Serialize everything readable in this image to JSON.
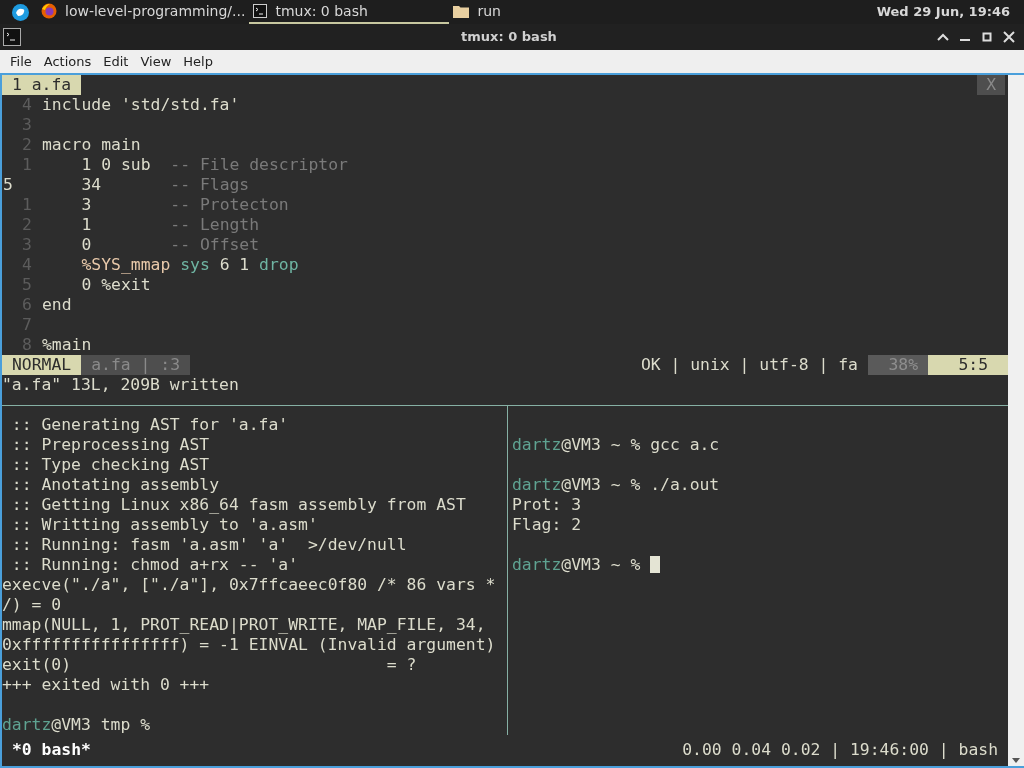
{
  "panel": {
    "tasks": [
      {
        "label": "low-level-programming/...",
        "kind": "browser",
        "selected": false
      },
      {
        "label": "tmux: 0 bash",
        "kind": "terminal",
        "selected": true
      },
      {
        "label": "run",
        "kind": "folder",
        "selected": false
      }
    ],
    "clock": "Wed 29 Jun, 19:46"
  },
  "window": {
    "title": "tmux: 0 bash"
  },
  "menu": [
    "File",
    "Actions",
    "Edit",
    "View",
    "Help"
  ],
  "editor": {
    "tab": "1 a.fa",
    "close": "X",
    "lines": [
      {
        "number": "4",
        "current": false,
        "segments": [
          {
            "text": "include 'std/std.fa'",
            "kind": "text"
          }
        ]
      },
      {
        "number": "3",
        "current": false
      },
      {
        "number": "2",
        "current": false,
        "segments": [
          {
            "text": "macro main",
            "kind": "text"
          }
        ]
      },
      {
        "number": "1",
        "current": false,
        "segments": [
          {
            "text": "    1 0 sub  ",
            "kind": "text"
          },
          {
            "text": "-- File descriptor",
            "kind": "comment"
          }
        ]
      },
      {
        "number": "5",
        "current": true,
        "segments": [
          {
            "text": "    34       ",
            "kind": "text"
          },
          {
            "text": "-- Flags",
            "kind": "comment"
          }
        ]
      },
      {
        "number": "1",
        "current": false,
        "segments": [
          {
            "text": "    3        ",
            "kind": "text"
          },
          {
            "text": "-- Protecton",
            "kind": "comment"
          }
        ]
      },
      {
        "number": "2",
        "current": false,
        "segments": [
          {
            "text": "    1        ",
            "kind": "text"
          },
          {
            "text": "-- Length",
            "kind": "comment"
          }
        ]
      },
      {
        "number": "3",
        "current": false,
        "segments": [
          {
            "text": "    0        ",
            "kind": "text"
          },
          {
            "text": "-- Offset",
            "kind": "comment"
          }
        ]
      },
      {
        "number": "4",
        "current": false,
        "segments": [
          {
            "text": "    %SYS_mmap ",
            "kind": "macro"
          },
          {
            "text": "sys",
            "kind": "builtin"
          },
          {
            "text": " 6 1 ",
            "kind": "text"
          },
          {
            "text": "drop",
            "kind": "builtin"
          }
        ]
      },
      {
        "number": "5",
        "current": false,
        "segments": [
          {
            "text": "    0 %exit",
            "kind": "text"
          }
        ]
      },
      {
        "number": "6",
        "current": false,
        "segments": [
          {
            "text": "end",
            "kind": "text"
          }
        ]
      },
      {
        "number": "7",
        "current": false
      },
      {
        "number": "8",
        "current": false,
        "segments": [
          {
            "text": "%main",
            "kind": "text"
          }
        ]
      }
    ],
    "statusline": {
      "mode": "NORMAL",
      "file": "a.fa | :3",
      "info": "OK | unix | utf-8 | fa",
      "percent": "38%",
      "position": "5:5"
    },
    "message": "\"a.fa\" 13L, 209B written"
  },
  "left_pane": [
    {
      "kind": "output",
      "text": " :: Generating AST for 'a.fa'"
    },
    {
      "kind": "output",
      "text": " :: Preprocessing AST"
    },
    {
      "kind": "output",
      "text": " :: Type checking AST"
    },
    {
      "kind": "output",
      "text": " :: Anotating assembly"
    },
    {
      "kind": "output",
      "text": " :: Getting Linux x86_64 fasm assembly from AST"
    },
    {
      "kind": "output",
      "text": " :: Writting assembly to 'a.asm'"
    },
    {
      "kind": "output",
      "text": " :: Running: fasm 'a.asm' 'a'  >/dev/null"
    },
    {
      "kind": "output",
      "text": " :: Running: chmod a+rx -- 'a'"
    },
    {
      "kind": "output",
      "text": "execve(\"./a\", [\"./a\"], 0x7ffcaeec0f80 /* 86 vars *"
    },
    {
      "kind": "output",
      "text": "/) = 0"
    },
    {
      "kind": "output",
      "text": "mmap(NULL, 1, PROT_READ|PROT_WRITE, MAP_FILE, 34,"
    },
    {
      "kind": "output",
      "text": "0xffffffffffffffff) = -1 EINVAL (Invalid argument)"
    },
    {
      "kind": "output",
      "text": "exit(0)                                = ?"
    },
    {
      "kind": "output",
      "text": "+++ exited with 0 +++"
    },
    {
      "kind": "blank"
    },
    {
      "kind": "prompt",
      "user": "dartz",
      "rest": "@VM3 tmp %"
    }
  ],
  "right_pane": [
    {
      "kind": "blank"
    },
    {
      "kind": "prompt",
      "user": "dartz",
      "rest": "@VM3 ~ % gcc a.c"
    },
    {
      "kind": "blank"
    },
    {
      "kind": "prompt",
      "user": "dartz",
      "rest": "@VM3 ~ % ./a.out"
    },
    {
      "kind": "output",
      "text": "Prot: 3"
    },
    {
      "kind": "output",
      "text": "Flag: 2"
    },
    {
      "kind": "blank"
    },
    {
      "kind": "prompt",
      "user": "dartz",
      "rest": "@VM3 ~ % ",
      "cursor": true
    }
  ],
  "tmux_status": {
    "session": "*0 bash*",
    "info": "0.00 0.04 0.02 | 19:46:00 | bash"
  }
}
